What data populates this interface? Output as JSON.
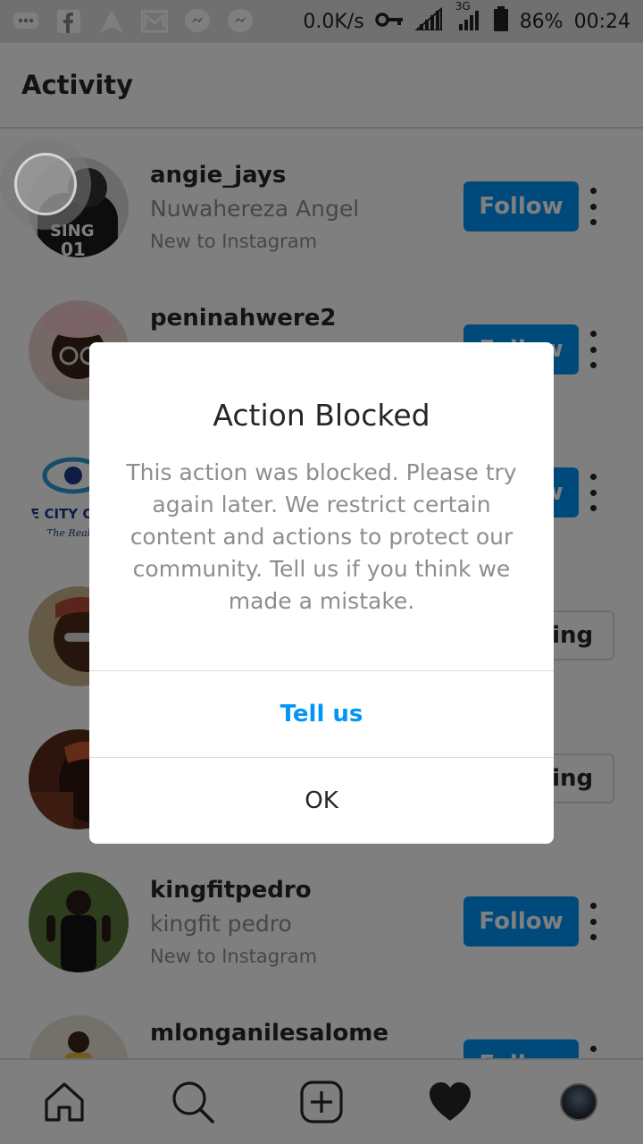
{
  "status_bar": {
    "network_speed": "0.0K/s",
    "network_type": "3G",
    "battery": "86%",
    "time": "00:24",
    "icons": [
      "messaging-icon",
      "facebook-icon",
      "navigation-icon",
      "gmail-icon",
      "messenger-icon",
      "messenger-icon",
      "vpn-key-icon",
      "signal-icon",
      "signal-3g-icon",
      "battery-icon"
    ]
  },
  "header": {
    "title": "Activity"
  },
  "activity": [
    {
      "username": "angie_jays",
      "fullname": "Nuwahereza Angel",
      "note": "New to Instagram",
      "button": "Follow"
    },
    {
      "username": "peninahwere2",
      "fullname": "",
      "note": "",
      "button": "Follow"
    },
    {
      "username": "",
      "fullname": "",
      "note": "",
      "button": "Follow",
      "avatar_text": "E CITY C",
      "avatar_subtext": "The Real"
    },
    {
      "username": "",
      "fullname": "",
      "note": "",
      "button": "Following"
    },
    {
      "username": "",
      "fullname": "",
      "note": "",
      "button": "Following"
    },
    {
      "username": "kingfitpedro",
      "fullname": "kingfit pedro",
      "note": "New to Instagram",
      "button": "Follow"
    },
    {
      "username": "mlonganilesalome",
      "fullname": "",
      "note": "",
      "button": "Follow"
    }
  ],
  "dialog": {
    "title": "Action Blocked",
    "message": "This action was blocked. Please try again later. We restrict certain content and actions to protect our community. Tell us if you think we made a mistake.",
    "primary_button": "Tell us",
    "secondary_button": "OK"
  },
  "bottom_nav": {
    "items": [
      "home-icon",
      "search-icon",
      "new-post-icon",
      "activity-heart-icon",
      "profile-avatar"
    ]
  },
  "colors": {
    "accent": "#0095f6",
    "text_primary": "#262626",
    "text_secondary": "#8e8e8e",
    "overlay": "rgba(0,0,0,0.5)"
  }
}
